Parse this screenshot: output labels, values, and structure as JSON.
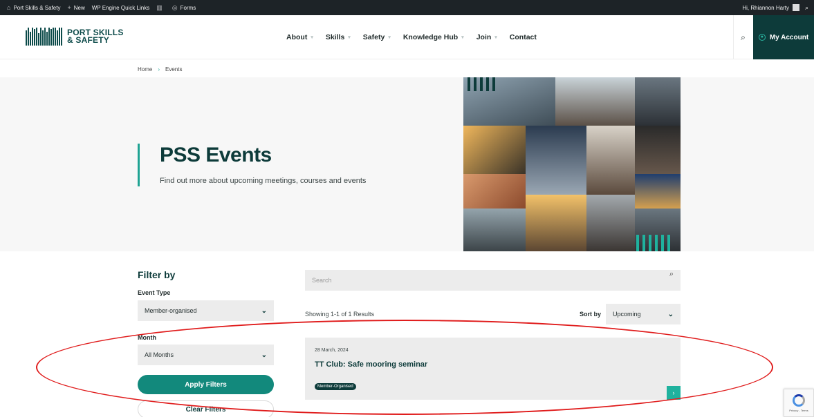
{
  "admin_bar": {
    "site_name": "Port Skills & Safety",
    "new_label": "New",
    "quick_links": "WP Engine Quick Links",
    "forms_label": "Forms",
    "greeting": "Hi, Rhiannon Harty"
  },
  "header": {
    "logo_line1": "PORT SKILLS",
    "logo_line2": "& SAFETY",
    "nav": [
      {
        "label": "About"
      },
      {
        "label": "Skills"
      },
      {
        "label": "Safety"
      },
      {
        "label": "Knowledge Hub"
      },
      {
        "label": "Join"
      },
      {
        "label": "Contact"
      }
    ],
    "account_label": "My Account"
  },
  "breadcrumb": {
    "home": "Home",
    "separator": "›",
    "current": "Events"
  },
  "hero": {
    "title": "PSS Events",
    "subtitle": "Find out more about upcoming meetings, courses and events"
  },
  "filters": {
    "title": "Filter by",
    "event_type_label": "Event Type",
    "event_type_value": "Member-organised",
    "month_label": "Month",
    "month_value": "All Months",
    "apply_label": "Apply Filters",
    "clear_label": "Clear Filters"
  },
  "results": {
    "search_placeholder": "Search",
    "count_text": "Showing 1-1 of 1 Results",
    "sort_label": "Sort by",
    "sort_value": "Upcoming",
    "events": [
      {
        "date": "28 March, 2024",
        "title": "TT Club: Safe mooring seminar",
        "badge": "Member-Organised"
      }
    ]
  },
  "recaptcha": {
    "text": "Privacy - Terms"
  },
  "colors": {
    "brand_dark": "#0d3b3a",
    "brand_teal": "#12897c",
    "accent_teal": "#1fb29e",
    "annotation_red": "#e01c1c"
  }
}
